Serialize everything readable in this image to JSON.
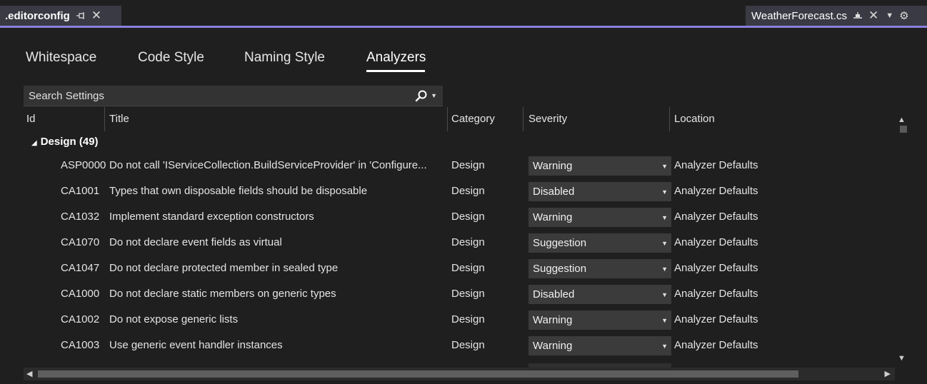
{
  "doc_tabs": {
    "active": {
      "title": ".editorconfig",
      "pin_icon": "pin-icon",
      "close_icon": "close-icon"
    },
    "other": {
      "title": "WeatherForecast.cs",
      "pin_icon": "pinned-icon",
      "close_icon": "close-icon"
    },
    "overflow_icon": "chevron-down-icon",
    "settings_icon": "gear-icon",
    "accent_color": "#8a7fe0"
  },
  "settings_tabs": [
    {
      "label": "Whitespace"
    },
    {
      "label": "Code Style"
    },
    {
      "label": "Naming Style"
    },
    {
      "label": "Analyzers",
      "active": true
    }
  ],
  "search": {
    "placeholder": "Search Settings",
    "icon": "search-icon"
  },
  "columns": {
    "id": "Id",
    "title": "Title",
    "category": "Category",
    "severity": "Severity",
    "location": "Location"
  },
  "group": {
    "label": "Design (49)"
  },
  "rows": [
    {
      "id": "ASP0000",
      "title": "Do not call 'IServiceCollection.BuildServiceProvider' in 'Configure...",
      "category": "Design",
      "severity": "Warning",
      "location": "Analyzer Defaults"
    },
    {
      "id": "CA1001",
      "title": "Types that own disposable fields should be disposable",
      "category": "Design",
      "severity": "Disabled",
      "location": "Analyzer Defaults"
    },
    {
      "id": "CA1032",
      "title": "Implement standard exception constructors",
      "category": "Design",
      "severity": "Warning",
      "location": "Analyzer Defaults"
    },
    {
      "id": "CA1070",
      "title": "Do not declare event fields as virtual",
      "category": "Design",
      "severity": "Suggestion",
      "location": "Analyzer Defaults"
    },
    {
      "id": "CA1047",
      "title": "Do not declare protected member in sealed type",
      "category": "Design",
      "severity": "Suggestion",
      "location": "Analyzer Defaults"
    },
    {
      "id": "CA1000",
      "title": "Do not declare static members on generic types",
      "category": "Design",
      "severity": "Disabled",
      "location": "Analyzer Defaults"
    },
    {
      "id": "CA1002",
      "title": "Do not expose generic lists",
      "category": "Design",
      "severity": "Warning",
      "location": "Analyzer Defaults"
    },
    {
      "id": "CA1003",
      "title": "Use generic event handler instances",
      "category": "Design",
      "severity": "Warning",
      "location": "Analyzer Defaults"
    }
  ]
}
